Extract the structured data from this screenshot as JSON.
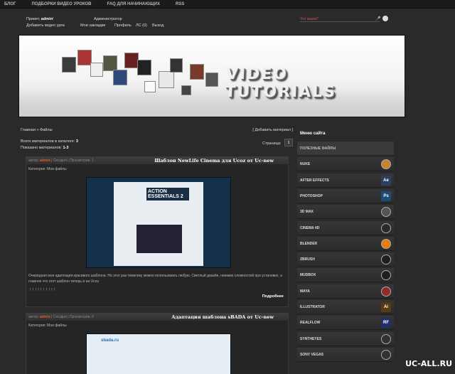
{
  "topnav": [
    "БЛОГ",
    "ПОДБОРКИ ВИДЕО УРОКОВ",
    "FAQ ДЛЯ НАЧИНАЮЩИХ",
    "RSS"
  ],
  "header": {
    "greeting_prefix": "Привет,",
    "username": "admin",
    "role": "Администратор",
    "links": [
      "Добавить видео урок",
      "Мои закладки",
      "Профиль",
      "ЛС (0)",
      "Выход"
    ],
    "search_placeholder": "Что ищем?"
  },
  "banner": {
    "title": "VIDEO TUTORIALS"
  },
  "content": {
    "breadcrumb": "Главная » Файлы",
    "add_material": "[ Добавить материал ]",
    "total_label": "Всего материалов в каталоге:",
    "total_value": "3",
    "shown_label": "Показано материалов:",
    "shown_value": "1-3",
    "pages_label": "Страница:",
    "current_page": "1"
  },
  "posts": [
    {
      "meta_prefix": "автор:",
      "author": "admin",
      "meta_rest": "| Сегодня | Просмотров: 1",
      "title": "Шаблон NewLife Cinema для Ucoz от Uc-new",
      "category_label": "Категория:",
      "category": "Мои файлы",
      "thumb_heading": "ACTION ESSENTIALS 2",
      "description": "Очередная моя адаптация красивого шаблона. Но этот раз тематику можно использовать любую. Светлый дизайн, никаких сложностей при установке, а главное что этот шаблон теперь и на Ucoz.",
      "rating": "! ! ! ! ! ! ! ! ! !",
      "more": "Подробнее"
    },
    {
      "meta_prefix": "автор:",
      "author": "admin",
      "meta_rest": "| Сегодня | Просмотров: 0",
      "title": "Адаптация шаблона sBADA от Uc-new",
      "category_label": "Категория:",
      "category": "Мои файлы",
      "thumb_heading": "sbada.ru"
    }
  ],
  "sidebar": {
    "title": "Меню сайта",
    "items": [
      {
        "label": "ПОЛЕЗНЫЕ ФАЙЛЫ",
        "icon": "",
        "group": true
      },
      {
        "label": "NUKE",
        "icon": "nuke-icon",
        "icon_text": "",
        "icon_color": "#c7832e"
      },
      {
        "label": "AFTER EFFECTS",
        "icon": "after-effects-icon",
        "icon_text": "Ae",
        "icon_color": "#2f3e5f"
      },
      {
        "label": "PHOTOSHOP",
        "icon": "photoshop-icon",
        "icon_text": "Ps",
        "icon_color": "#1d4c7a"
      },
      {
        "label": "3D MAX",
        "icon": "3dsmax-icon",
        "icon_text": "",
        "icon_color": "#555555"
      },
      {
        "label": "CINEMA 4D",
        "icon": "cinema4d-icon",
        "icon_text": "",
        "icon_color": "#2a2a2a"
      },
      {
        "label": "BLENDER",
        "icon": "blender-icon",
        "icon_text": "",
        "icon_color": "#e87d0d"
      },
      {
        "label": "ZBRUSH",
        "icon": "zbrush-icon",
        "icon_text": "",
        "icon_color": "#1e1e1e"
      },
      {
        "label": "MUDBOX",
        "icon": "mudbox-icon",
        "icon_text": "",
        "icon_color": "#1e1e1e"
      },
      {
        "label": "MAYA",
        "icon": "maya-icon",
        "icon_text": "",
        "icon_color": "#8e2a2a"
      },
      {
        "label": "ILLUSTRATOR",
        "icon": "illustrator-icon",
        "icon_text": "Ai",
        "icon_color": "#5b3a13"
      },
      {
        "label": "REALFLOW",
        "icon": "realflow-icon",
        "icon_text": "RF",
        "icon_color": "#22306a"
      },
      {
        "label": "SYNTHEYES",
        "icon": "syntheyes-icon",
        "icon_text": "",
        "icon_color": "#333333"
      },
      {
        "label": "SONY VEGAS",
        "icon": "sony-vegas-icon",
        "icon_text": "",
        "icon_color": "#333333"
      }
    ]
  },
  "watermark": "UC-ALL.RU"
}
